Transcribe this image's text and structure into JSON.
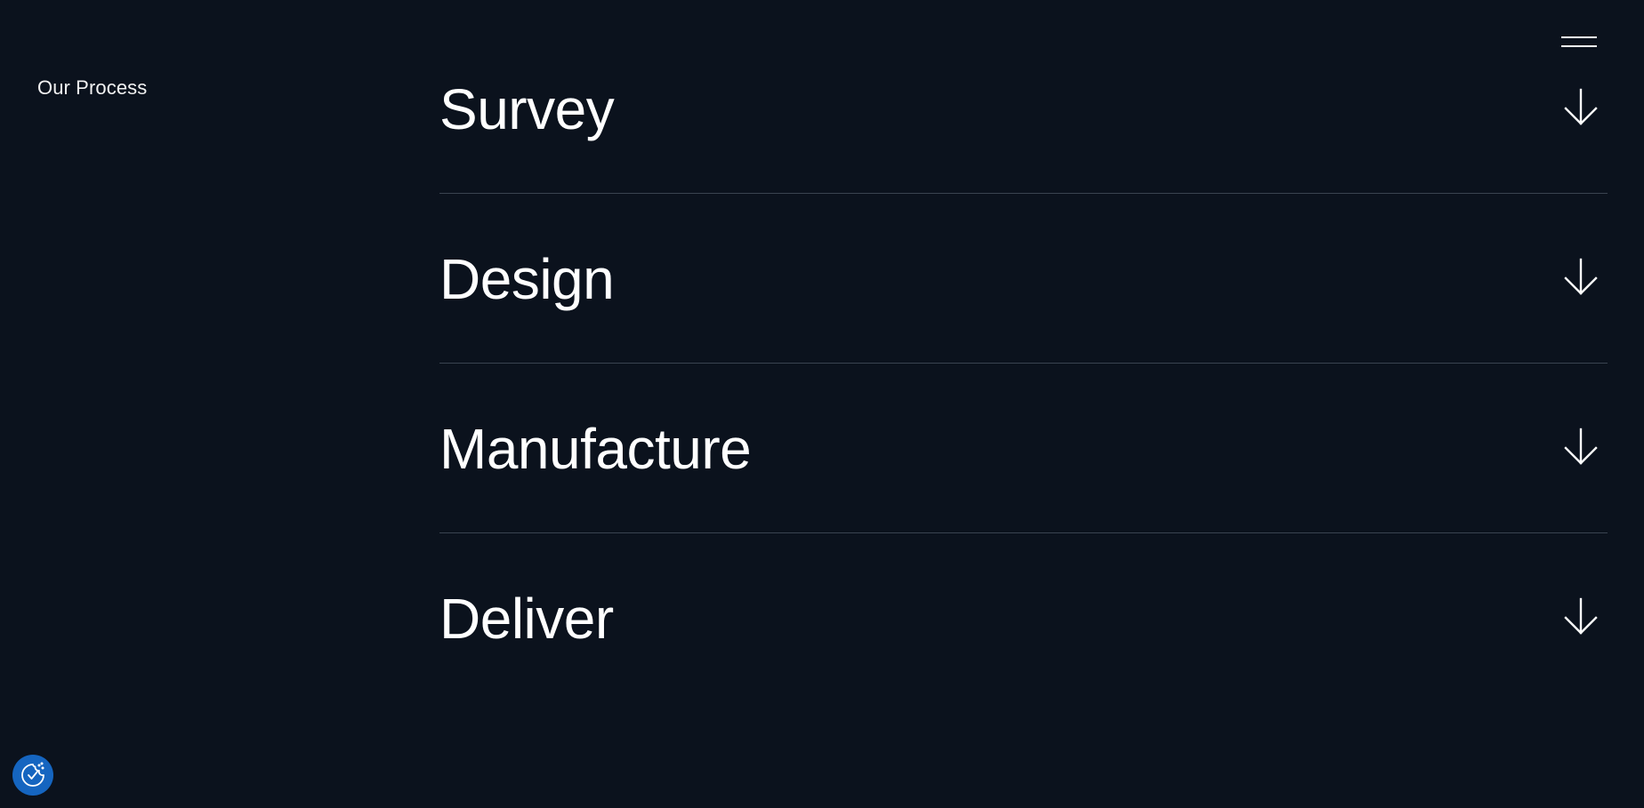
{
  "header": {
    "menu_icon": "hamburger-menu-icon"
  },
  "section": {
    "label": "Our Process"
  },
  "process_steps": [
    {
      "title": "Survey",
      "icon": "arrow-down-icon"
    },
    {
      "title": "Design",
      "icon": "arrow-down-icon"
    },
    {
      "title": "Manufacture",
      "icon": "arrow-down-icon"
    },
    {
      "title": "Deliver",
      "icon": "arrow-down-icon"
    }
  ],
  "cookie_settings": {
    "icon": "cookie-consent-icon",
    "color": "#1565c0"
  },
  "colors": {
    "background": "#0b121d",
    "text": "#ffffff",
    "divider": "#3a4350"
  }
}
